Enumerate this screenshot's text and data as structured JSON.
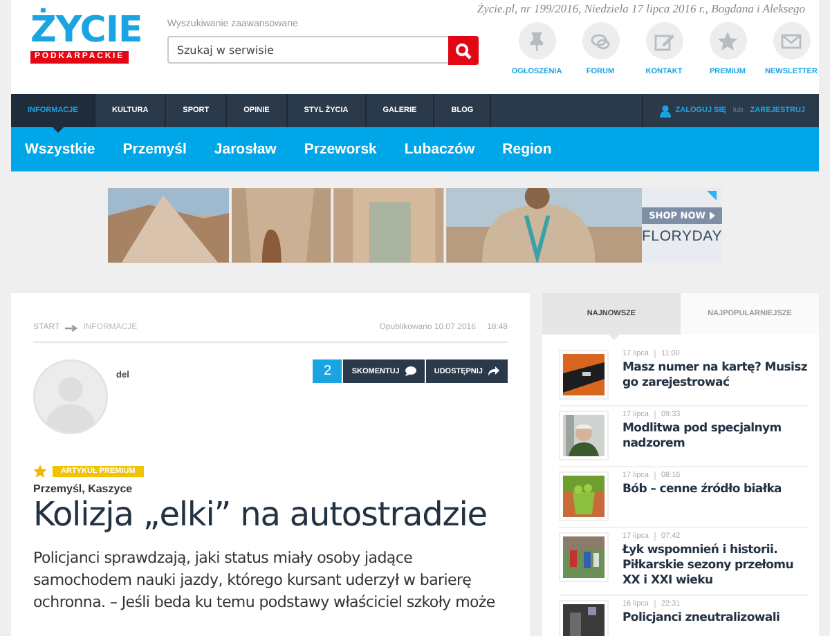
{
  "header": {
    "date_line": "Życie.pl, nr 199/2016, Niedziela 17 lipca 2016 r., Bogdana i Aleksego",
    "logo": {
      "title": "ŻYCIE",
      "subtitle": "PODKARPACKIE"
    },
    "search": {
      "advanced_link": "Wyszukiwanie zaawansowane",
      "placeholder": "Szukaj w serwisie"
    },
    "quick_links": [
      {
        "label": "OGŁOSZENIA",
        "kind": "pin"
      },
      {
        "label": "FORUM",
        "kind": "chat"
      },
      {
        "label": "KONTAKT",
        "kind": "edit"
      },
      {
        "label": "PREMIUM",
        "kind": "star"
      },
      {
        "label": "NEWSLETTER",
        "kind": "mail"
      }
    ]
  },
  "nav": {
    "items": [
      {
        "label": "INFORMACJE",
        "selected": true
      },
      {
        "label": "KULTURA",
        "selected": false
      },
      {
        "label": "SPORT",
        "selected": false
      },
      {
        "label": "OPINIE",
        "selected": false
      },
      {
        "label": "STYL ŻYCIA",
        "selected": false
      },
      {
        "label": "GALERIE",
        "selected": false
      },
      {
        "label": "BLOG",
        "selected": false
      }
    ],
    "auth": {
      "login": "ZALOGUJ SIĘ",
      "separator": "lub",
      "register": "ZAREJESTRUJ"
    }
  },
  "subnav": {
    "items": [
      {
        "label": "Wszystkie"
      },
      {
        "label": "Przemyśl"
      },
      {
        "label": "Jarosław"
      },
      {
        "label": "Przeworsk"
      },
      {
        "label": "Lubaczów"
      },
      {
        "label": "Region"
      }
    ]
  },
  "ad": {
    "button": "SHOP NOW",
    "brand": "FLORYDAY"
  },
  "article": {
    "breadcrumb": [
      "START",
      "INFORMACJE"
    ],
    "published": "Opublikowano 10.07.2016",
    "time": "18:48",
    "author": "del",
    "comments_count": "2",
    "comment_button": "SKOMENTUJ",
    "share_button": "UDOSTĘPNIJ",
    "badge": "ARTYKUŁ PREMIUM",
    "location": "Przemyśl, Kaszyce",
    "title": "Kolizja „elki” na autostradzie",
    "lead": "Policjanci sprawdzają, jaki status miały osoby jadące samochodem nauki jazdy, którego kursant uderzył w barierę ochronna. – Jeśli beda ku temu podstawy właściciel szkoły może"
  },
  "sidebar": {
    "tabs": [
      {
        "label": "NAJNOWSZE",
        "selected": true
      },
      {
        "label": "NAJPOPULARNIEJSZE",
        "selected": false
      }
    ],
    "items": [
      {
        "date": "17 lipca",
        "time": "11:00",
        "title": "Masz numer na kartę? Musisz go zarejestrować"
      },
      {
        "date": "17 lipca",
        "time": "09:33",
        "title": "Modlitwa pod specjalnym nadzorem"
      },
      {
        "date": "17 lipca",
        "time": "08:16",
        "title": "Bób – cenne źródło białka"
      },
      {
        "date": "17 lipca",
        "time": "07:42",
        "title": "Łyk wspomnień i historii. Piłkarskie sezony przełomu XX i XXI wieku"
      },
      {
        "date": "16 lipca",
        "time": "22:31",
        "title": "Policjanci zneutralizowali"
      }
    ]
  }
}
